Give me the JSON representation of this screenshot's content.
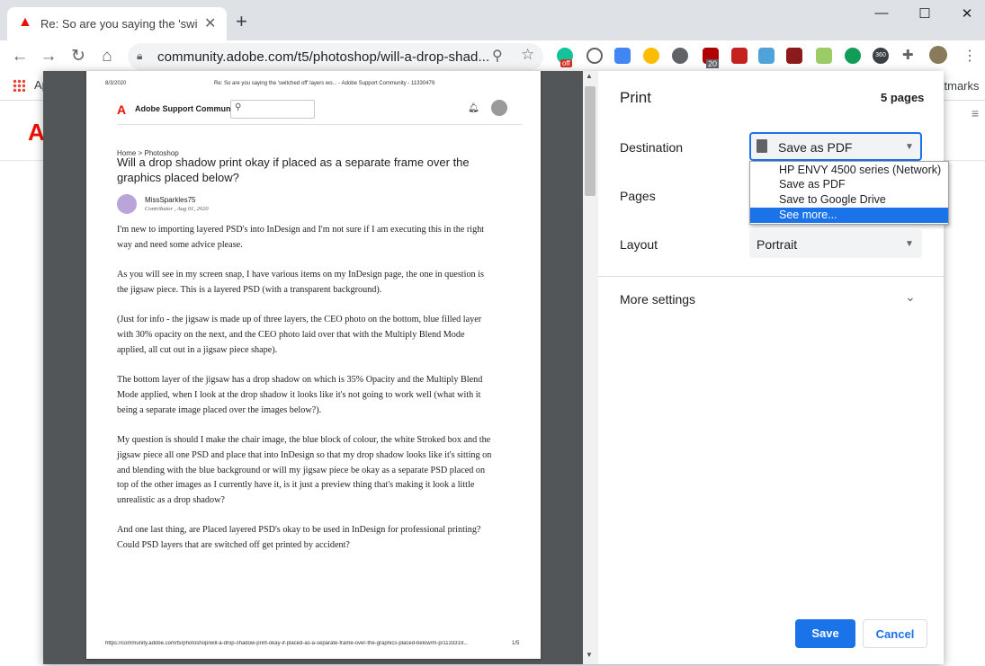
{
  "browser": {
    "tab_title": "Re: So are you saying the 'switche",
    "url": "community.adobe.com/t5/photoshop/will-a-drop-shad...",
    "bookmarks_apps": "Ap",
    "bookmarks_other": "ktmarks",
    "extension_badges": [
      "off",
      "20",
      "360"
    ]
  },
  "preview": {
    "header_date": "8/3/2020",
    "header_title": "Re: So are you saying the 'switched off' layers wo... - Adobe Support Community - 11330479",
    "site_name": "Adobe Support Community",
    "breadcrumb_home": "Home",
    "breadcrumb_sep": ">",
    "breadcrumb_section": "Photoshop",
    "post_title": "Will a drop shadow print okay if placed as a separate frame over the graphics placed below?",
    "author": "MissSparkles75",
    "author_meta": "Contributor , Aug 01, 2020",
    "paragraphs": [
      "I'm new to importing layered PSD's into InDesign and I'm not sure if I am executing this in the right way and need some advice please.",
      "As you will see in my screen snap, I have various items on my InDesign page, the one in question is the jigsaw piece. This is a layered PSD (with a transparent background).",
      "(Just for info - the jigsaw is made up of three layers, the CEO photo on the bottom, blue filled layer with 30% opacity on the next, and the CEO photo laid over that with the Multiply Blend Mode applied, all cut out in a jigsaw piece shape).",
      "The bottom layer of the jigsaw has a drop shadow on which is 35% Opacity and the Multiply Blend Mode applied, when I look at the drop shadow it looks like it's not going to work well (what with it being a separate image placed over the images below?).",
      "My question is should I make the chair image, the blue block of colour, the white Stroked box and the jigsaw piece all one PSD and place that into InDesign so that my drop shadow looks like it's sitting on and blending with the blue background or will my jigsaw piece be okay as a separate PSD placed on top of the other images as I currently have it, is it just a preview thing that's making it look a little unrealistic as a drop shadow?",
      "And one last thing, are Placed layered PSD's okay to be used in InDesign for professional printing? Could PSD layers that are switched off get printed by accident?"
    ],
    "footer_url": "https://community.adobe.com/t5/photoshop/will-a-drop-shadow-print-okay-if-placed-as-a-separate-frame-over-the-graphics-placed-below/m-p/1133319...",
    "footer_page": "1/5"
  },
  "print": {
    "title": "Print",
    "page_count": "5 pages",
    "destination_label": "Destination",
    "destination_value": "Save as PDF",
    "destination_options": [
      "HP ENVY 4500 series (Network)",
      "Save as PDF",
      "Save to Google Drive",
      "See more..."
    ],
    "destination_highlighted_index": 3,
    "pages_label": "Pages",
    "layout_label": "Layout",
    "layout_value": "Portrait",
    "more_settings_label": "More settings",
    "save_label": "Save",
    "cancel_label": "Cancel"
  },
  "colors": {
    "accent": "#1a73e8",
    "adobe_red": "#eb1000",
    "menu_highlight": "#1a73e8"
  }
}
